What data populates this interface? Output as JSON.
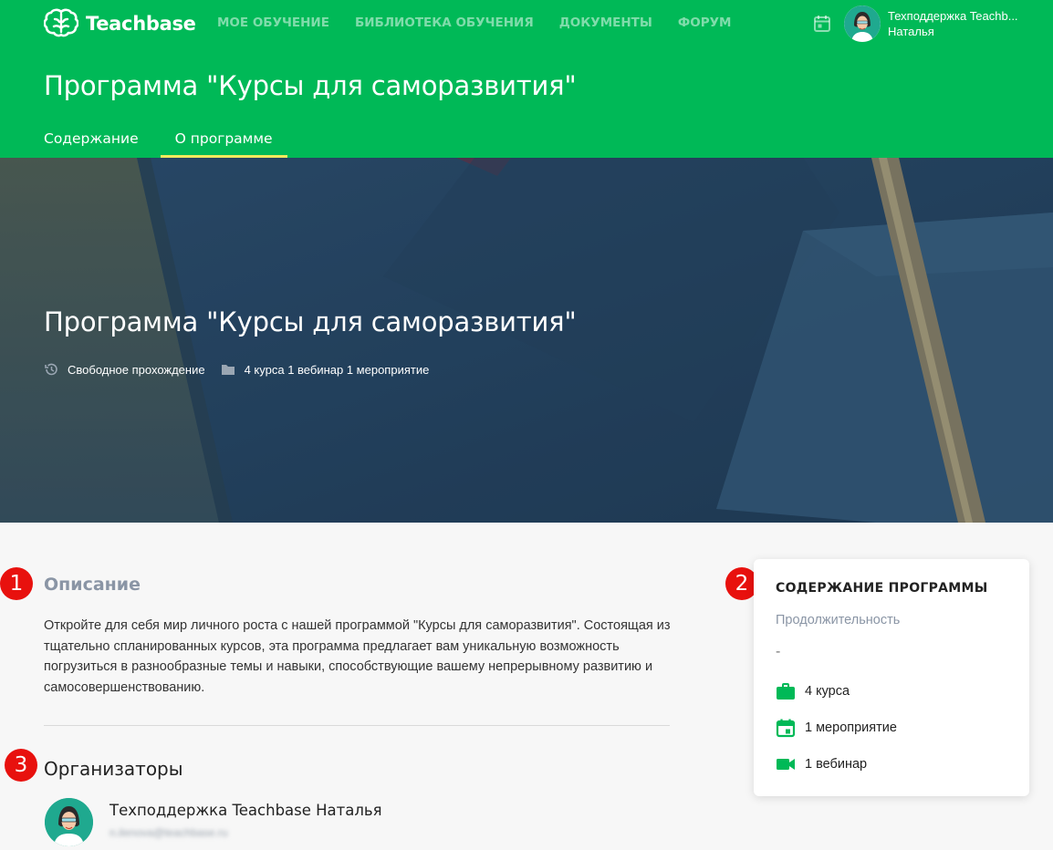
{
  "header": {
    "logo_text": "Teachbase",
    "nav": [
      "МОЕ ОБУЧЕНИЕ",
      "БИБЛИОТЕКА ОБУЧЕНИЯ",
      "ДОКУМЕНТЫ",
      "ФОРУМ"
    ],
    "user_line1": "Техподдержка Teachb...",
    "user_line2": "Наталья",
    "page_title": "Программа \"Курсы для саморазвития\"",
    "tabs": [
      "Содержание",
      "О программе"
    ],
    "active_tab": "О программе",
    "bg_color": "#00b957",
    "tab_underline_color": "#f1ea5d"
  },
  "hero": {
    "title": "Программа \"Курсы для саморазвития\"",
    "mode": "Свободное прохождение",
    "contents": "4 курса 1 вебинар 1 мероприятие"
  },
  "description": {
    "badge": "1",
    "heading": "Описание",
    "text": "Откройте для себя мир личного роста с нашей программой \"Курсы для саморазвития\". Состоящая из тщательно спланированных курсов, эта программа предлагает вам уникальную возможность погрузиться в разнообразные темы и навыки, способствующие вашему непрерывному развитию и самосовершенствованию."
  },
  "card": {
    "badge": "2",
    "title": "СОДЕРЖАНИЕ ПРОГРАММЫ",
    "duration_label": "Продолжительность",
    "duration_value": "-",
    "items": [
      {
        "icon": "briefcase-icon",
        "label": "4 курса"
      },
      {
        "icon": "calendar-icon",
        "label": "1 мероприятие"
      },
      {
        "icon": "video-icon",
        "label": "1 вебинар"
      }
    ],
    "icon_color": "#00b957"
  },
  "organizers": {
    "badge": "3",
    "heading": "Организаторы",
    "name": "Техподдержка Teachbase Наталья",
    "email": "n.ilenova@teachbase.ru"
  },
  "colors": {
    "badge": "#e8110e",
    "hero_bg": "#2b4a66",
    "muted": "#8a95a5"
  }
}
